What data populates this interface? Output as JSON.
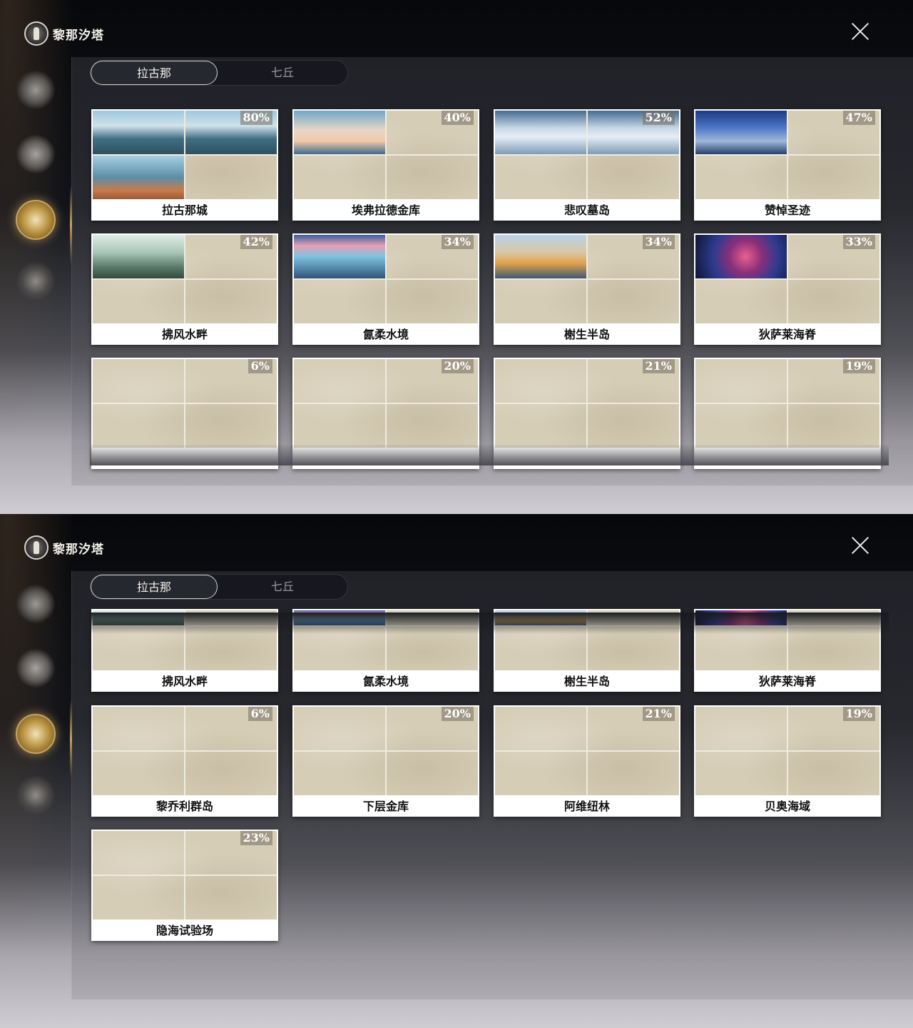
{
  "header": {
    "title": "黎那汐塔"
  },
  "tabs": [
    "拉古那",
    "七丘"
  ],
  "panel1": {
    "cards": [
      {
        "name": "拉古那城",
        "percent": "80%"
      },
      {
        "name": "埃弗拉德金库",
        "percent": "40%"
      },
      {
        "name": "悲叹墓岛",
        "percent": "52%"
      },
      {
        "name": "赞悼圣迹",
        "percent": "47%"
      },
      {
        "name": "拂风水畔",
        "percent": "42%"
      },
      {
        "name": "氤柔水境",
        "percent": "34%"
      },
      {
        "name": "榭生半岛",
        "percent": "34%"
      },
      {
        "name": "狄萨莱海脊",
        "percent": "33%"
      },
      {
        "name": "",
        "percent": "6%"
      },
      {
        "name": "",
        "percent": "20%"
      },
      {
        "name": "",
        "percent": "21%"
      },
      {
        "name": "",
        "percent": "19%"
      }
    ]
  },
  "panel2": {
    "cards": [
      {
        "name": "拂风水畔"
      },
      {
        "name": "氤柔水境"
      },
      {
        "name": "榭生半岛"
      },
      {
        "name": "狄萨莱海脊"
      },
      {
        "name": "黎乔利群岛",
        "percent": "6%"
      },
      {
        "name": "下层金库",
        "percent": "20%"
      },
      {
        "name": "阿维纽林",
        "percent": "21%"
      },
      {
        "name": "贝奥海域",
        "percent": "19%"
      },
      {
        "name": "隐海试验场",
        "percent": "23%"
      }
    ]
  },
  "icons": {
    "close": "close-x-icon",
    "logo": "region-emblem-icon",
    "sidebar": [
      "region-emblem-1-icon",
      "region-emblem-2-icon",
      "region-emblem-3-icon",
      "region-emblem-4-icon"
    ]
  },
  "colors": {
    "accent_gold": "#c9a35e",
    "card_map": "#d6cdb6"
  }
}
